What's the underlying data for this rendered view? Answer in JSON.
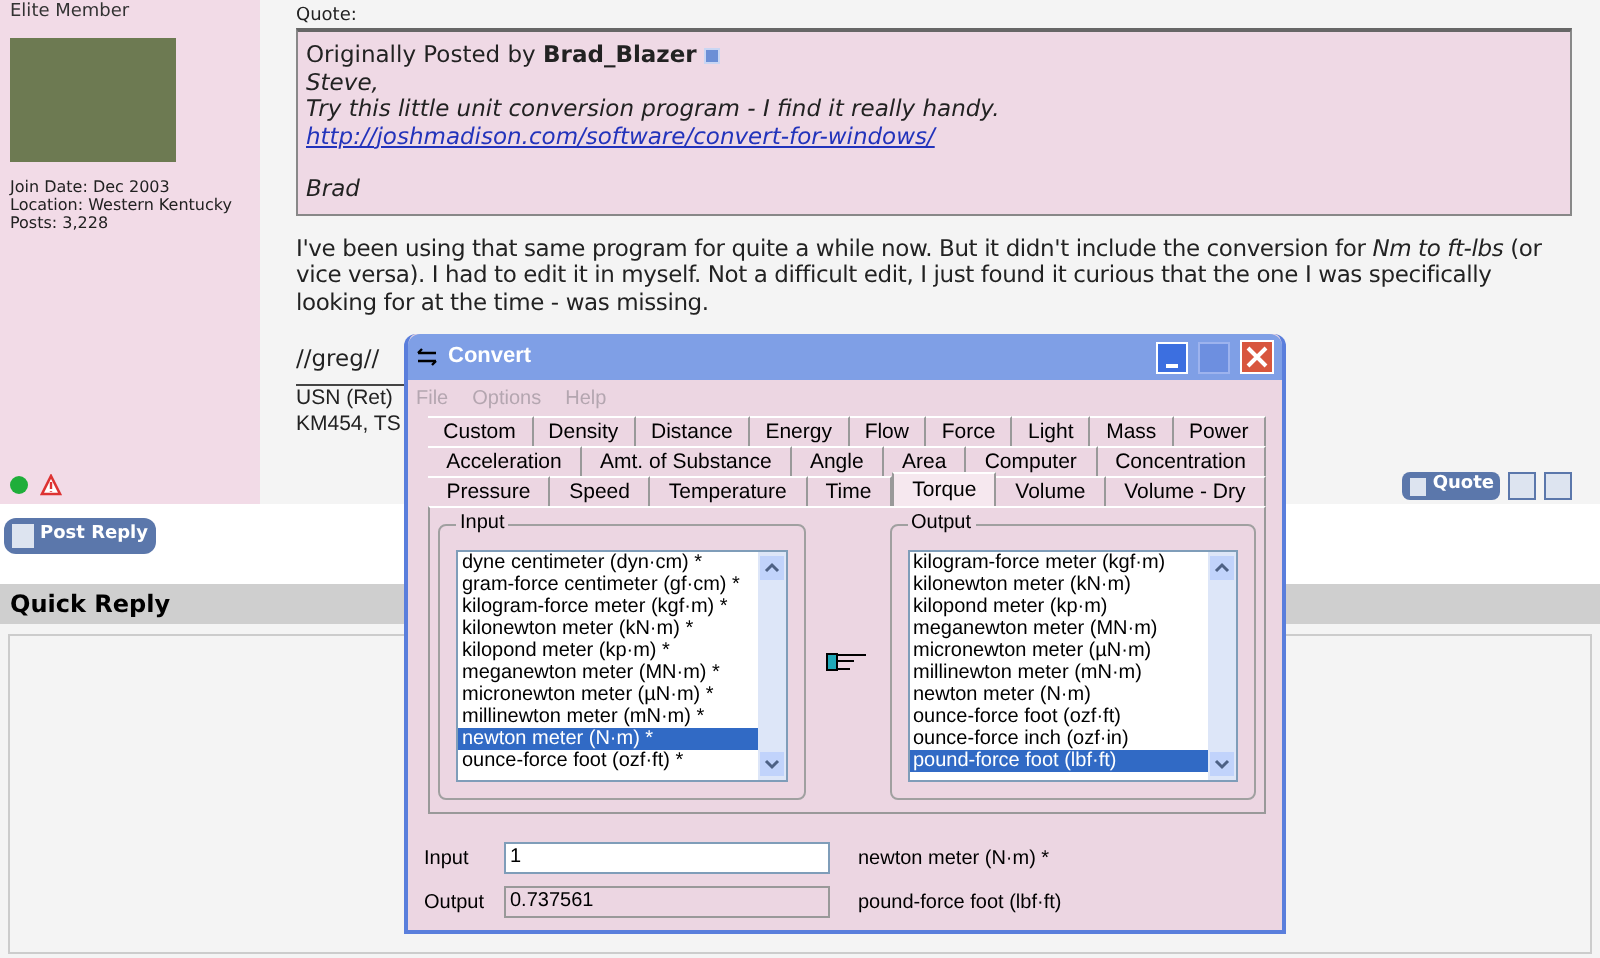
{
  "post": {
    "user_title": "Elite Member",
    "user_info": [
      "Join Date: Dec 2003",
      "Location: Western Kentucky",
      "Posts: 3,228"
    ],
    "online": true,
    "quote": {
      "label": "Quote:",
      "prefix": "Originally Posted by",
      "author": "Brad_Blazer",
      "lines": [
        "Steve,",
        "Try this little unit conversion program - I find it really handy."
      ],
      "link": "http://joshmadison.com/software/convert-for-windows/",
      "signoff": "Brad"
    },
    "body": "I've been using that same program for quite a while now. But it didn't include the conversion for *Nm to ft-lbs* (or vice versa). I had to edit it in myself. Not a difficult edit, I just found it curious that the one I was specifically looking for at the time - was missing.",
    "sign": "//greg//",
    "signature": [
      "USN (Ret)",
      "KM454, TS"
    ],
    "quote_button": "Quote"
  },
  "post_reply": "Post Reply",
  "quick_reply": {
    "title": "Quick Reply"
  },
  "convert_window": {
    "title": "Convert",
    "menu": [
      {
        "label": "File",
        "disabled": true
      },
      {
        "label": "Options",
        "disabled": true
      },
      {
        "label": "Help",
        "disabled": true
      }
    ],
    "tab_rows": [
      [
        {
          "label": "Custom",
          "selected": false
        },
        {
          "label": "Density",
          "selected": false
        },
        {
          "label": "Distance",
          "selected": false
        },
        {
          "label": "Energy",
          "selected": false
        },
        {
          "label": "Flow",
          "selected": false
        },
        {
          "label": "Force",
          "selected": false
        },
        {
          "label": "Light",
          "selected": false
        },
        {
          "label": "Mass",
          "selected": false
        },
        {
          "label": "Power",
          "selected": false
        }
      ],
      [
        {
          "label": "Acceleration",
          "selected": false
        },
        {
          "label": "Amt. of Substance",
          "selected": false
        },
        {
          "label": "Angle",
          "selected": false
        },
        {
          "label": "Area",
          "selected": false
        },
        {
          "label": "Computer",
          "selected": false
        },
        {
          "label": "Concentration",
          "selected": false
        }
      ],
      [
        {
          "label": "Pressure",
          "selected": false
        },
        {
          "label": "Speed",
          "selected": false
        },
        {
          "label": "Temperature",
          "selected": false
        },
        {
          "label": "Time",
          "selected": false
        },
        {
          "label": "Torque",
          "selected": true
        },
        {
          "label": "Volume",
          "selected": false
        },
        {
          "label": "Volume - Dry",
          "selected": false
        }
      ]
    ],
    "input_group": {
      "label": "Input",
      "items": [
        {
          "label": "dyne centimeter (dyn·cm) *",
          "selected": false
        },
        {
          "label": "gram-force centimeter (gf·cm) *",
          "selected": false
        },
        {
          "label": "kilogram-force meter (kgf·m) *",
          "selected": false
        },
        {
          "label": "kilonewton meter (kN·m) *",
          "selected": false
        },
        {
          "label": "kilopond meter (kp·m) *",
          "selected": false
        },
        {
          "label": "meganewton meter (MN·m) *",
          "selected": false
        },
        {
          "label": "micronewton meter (µN·m) *",
          "selected": false
        },
        {
          "label": "millinewton meter (mN·m) *",
          "selected": false
        },
        {
          "label": "newton meter (N·m) *",
          "selected": true
        },
        {
          "label": "ounce-force foot (ozf·ft) *",
          "selected": false
        }
      ]
    },
    "output_group": {
      "label": "Output",
      "items": [
        {
          "label": "kilogram-force meter (kgf·m)",
          "selected": false
        },
        {
          "label": "kilonewton meter (kN·m)",
          "selected": false
        },
        {
          "label": "kilopond meter (kp·m)",
          "selected": false
        },
        {
          "label": "meganewton meter (MN·m)",
          "selected": false
        },
        {
          "label": "micronewton meter (µN·m)",
          "selected": false
        },
        {
          "label": "millinewton meter (mN·m)",
          "selected": false
        },
        {
          "label": "newton meter (N·m)",
          "selected": false
        },
        {
          "label": "ounce-force foot (ozf·ft)",
          "selected": false
        },
        {
          "label": "ounce-force inch (ozf·in)",
          "selected": false
        },
        {
          "label": "pound-force foot (lbf·ft)",
          "selected": true
        }
      ]
    },
    "input": {
      "label": "Input",
      "value": "1",
      "unit": "newton meter (N·m) *"
    },
    "output": {
      "label": "Output",
      "value": "0.737561",
      "unit": "pound-force foot (lbf·ft)"
    }
  }
}
